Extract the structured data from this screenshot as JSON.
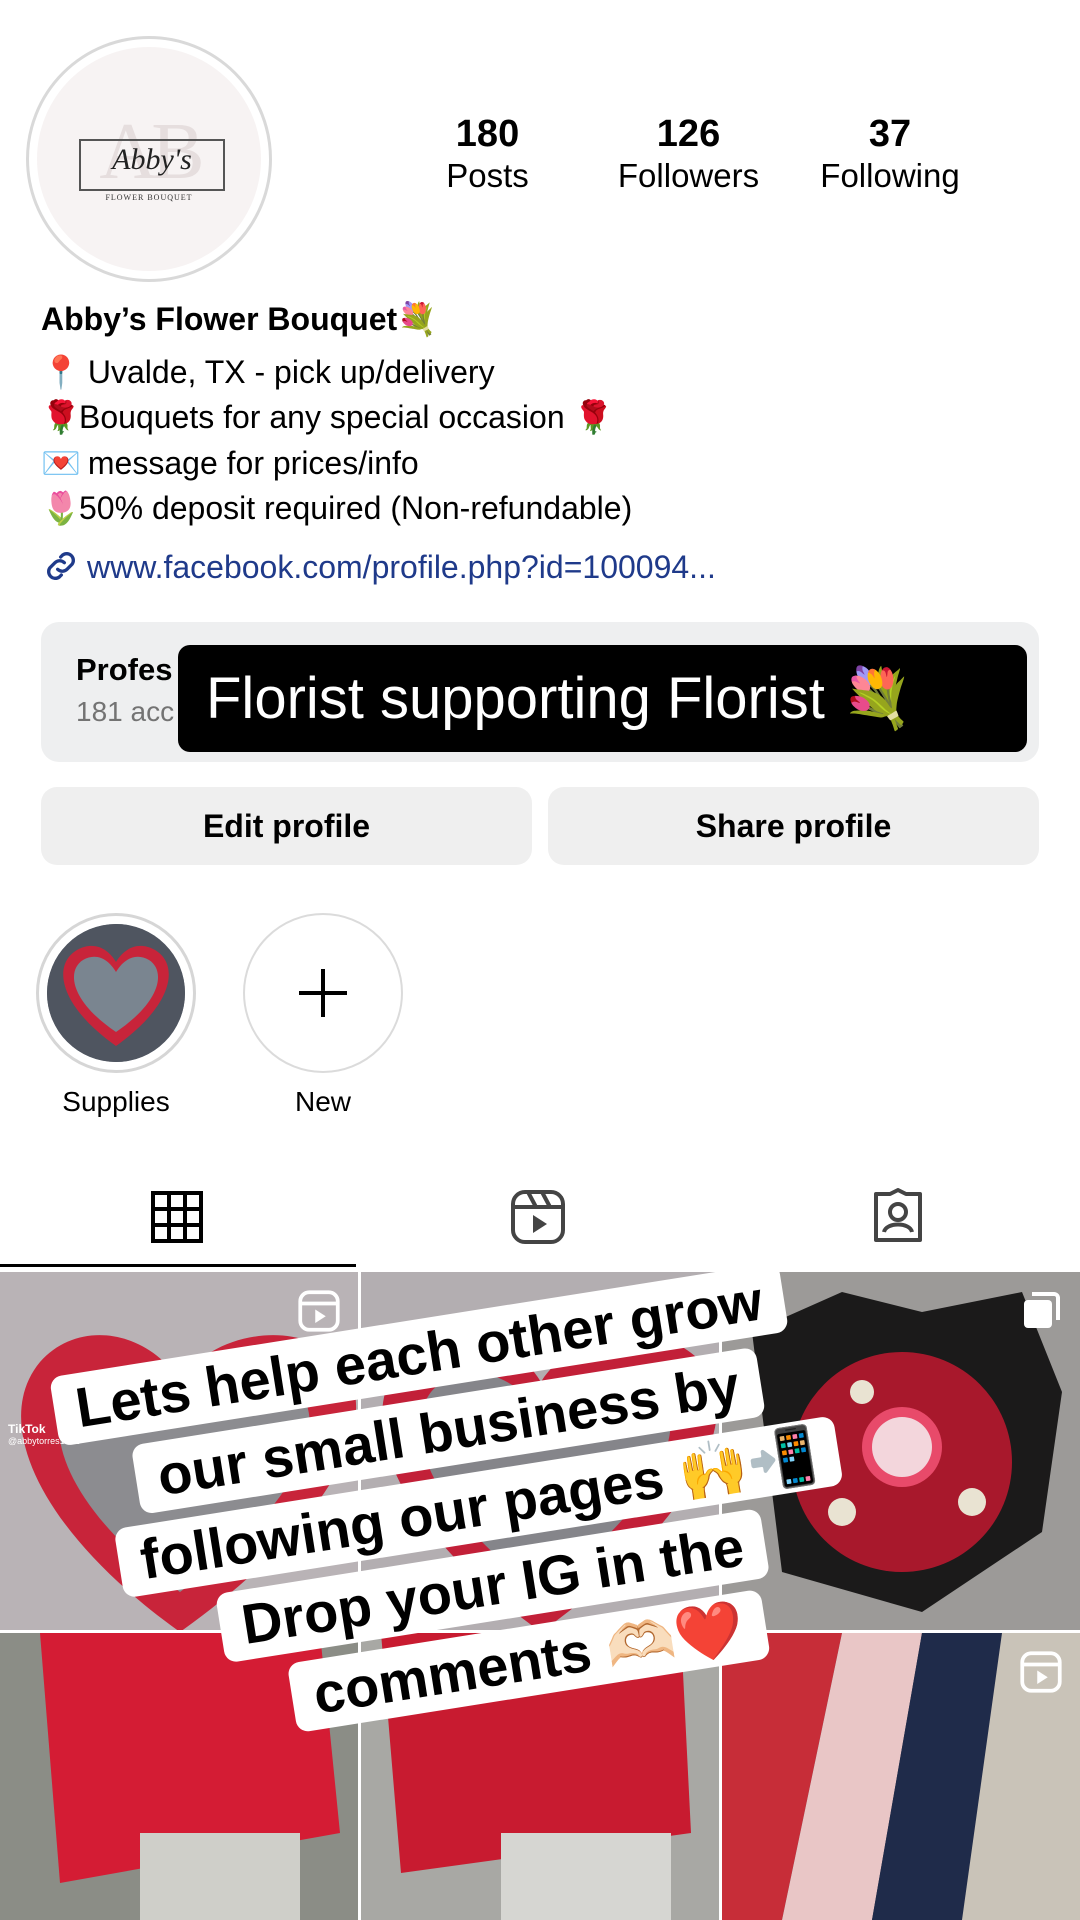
{
  "profile": {
    "stats": [
      {
        "value": "180",
        "label": "Posts"
      },
      {
        "value": "126",
        "label": "Followers"
      },
      {
        "value": "37",
        "label": "Following"
      }
    ],
    "avatar_logo": {
      "script": "Abby's",
      "subtext": "FLOWER BOUQUET",
      "monogram": "AB"
    },
    "name": "Abby’s Flower Bouquet💐",
    "bio": [
      {
        "emoji": "📍",
        "text": " Uvalde, TX - pick up/delivery"
      },
      {
        "emoji": "🌹",
        "text": "Bouquets for any special occasion 🌹"
      },
      {
        "emoji": "💌",
        "text": " message for prices/info"
      },
      {
        "emoji": "🌷",
        "text": "50% deposit required (Non-refundable)"
      }
    ],
    "link": "www.facebook.com/profile.php?id=100094..."
  },
  "dashboard": {
    "title": "Profes",
    "subtitle": "181 acc"
  },
  "overlay_banner": "Florist supporting Florist 💐",
  "buttons": {
    "edit": "Edit profile",
    "share": "Share profile"
  },
  "highlights": [
    {
      "label": "Supplies"
    },
    {
      "label": "New"
    }
  ],
  "tabs": [
    "grid-icon",
    "reels-icon",
    "tagged-icon"
  ],
  "grid_icons": {
    "reel": "reels-icon",
    "carousel": "carousel-icon"
  },
  "tiktok_watermark": {
    "brand": "TikTok",
    "user": "@abbytorres1991"
  },
  "sticker_lines": [
    "Lets help each other grow",
    "our small business by",
    "following our pages 🙌📲",
    "Drop your IG in the",
    "comments 🫶🏻❤️"
  ]
}
